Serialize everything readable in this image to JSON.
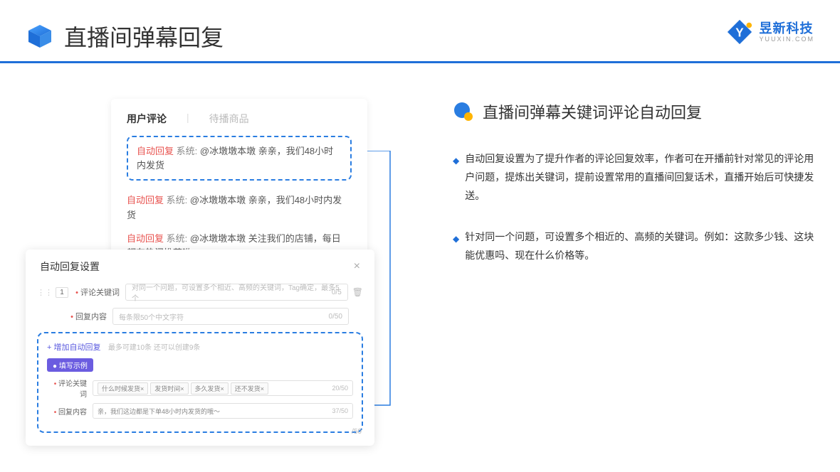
{
  "header": {
    "title": "直播间弹幕回复"
  },
  "brand": {
    "name": "昱新科技",
    "sub": "YUUXIN.COM"
  },
  "comments": {
    "tab_active": "用户评论",
    "tab_inactive": "待播商品",
    "highlight": {
      "tag": "自动回复",
      "sys": "系统:",
      "text": "@冰墩墩本墩 亲亲，我们48小时内发货"
    },
    "item2": {
      "tag": "自动回复",
      "sys": "系统:",
      "text": "@冰墩墩本墩 亲亲，我们48小时内发货"
    },
    "item3": {
      "tag": "自动回复",
      "sys": "系统:",
      "text": "@冰墩墩本墩 关注我们的店铺，每日都有热门推荐哟～"
    }
  },
  "modal": {
    "title": "自动回复设置",
    "row_num": "1",
    "label_keyword": "评论关键词",
    "placeholder_keyword": "对同一个问题，可设置多个相近、高频的关键词，Tag确定，最多5个",
    "count_keyword": "0/5",
    "label_content": "回复内容",
    "placeholder_content": "每条限50个中文字符",
    "count_content": "0/50",
    "add_link": "+ 增加自动回复",
    "add_hint": "最多可建10条 还可以创建9条",
    "badge": "● 填写示例",
    "ex_label_keyword": "评论关键词",
    "ex_tags": [
      "什么时候发货×",
      "发货时间×",
      "多久发货×",
      "还不发货×"
    ],
    "ex_count_keyword": "20/50",
    "ex_label_content": "回复内容",
    "ex_content": "亲，我们这边都是下单48小时内发货的哦～",
    "ex_count_content": "37/50",
    "bottom_count": "/50"
  },
  "right": {
    "section_title": "直播间弹幕关键词评论自动回复",
    "bullet1": "自动回复设置为了提升作者的评论回复效率，作者可在开播前针对常见的评论用户问题，提炼出关键词，提前设置常用的直播间回复话术，直播开始后可快捷发送。",
    "bullet2": "针对同一个问题，可设置多个相近的、高频的关键词。例如：这款多少钱、这块能优惠吗、现在什么价格等。"
  }
}
